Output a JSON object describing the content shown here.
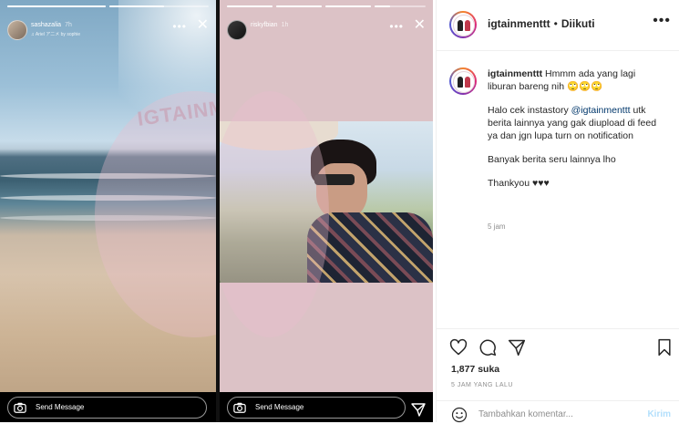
{
  "stories": {
    "left": {
      "username": "sashazalia",
      "time": "7h",
      "music": "♫ Ariel ア二メ by sophie",
      "reply_placeholder": "Send Message",
      "progress": [
        1,
        0.55
      ]
    },
    "right": {
      "username": "riskyfbian",
      "time": "1h",
      "reply_placeholder": "Send Message",
      "progress": [
        1,
        1,
        1,
        0.3
      ]
    },
    "watermark": "IGTAINMENTTT"
  },
  "post": {
    "header": {
      "username": "igtainmenttt",
      "separator": "•",
      "follow_label": "Diikuti"
    },
    "caption": {
      "username": "igtainmenttt",
      "line1": "Hmmm ada yang lagi liburan bareng nih 🙄🙄🙄",
      "para2_before": "Halo cek instastory ",
      "para2_mention": "@igtainmenttt",
      "para2_after": " utk berita lainnya yang gak diupload di feed ya dan jgn lupa turn on notification",
      "para3": "Banyak berita seru lainnya lho",
      "para4": "Thankyou ♥♥♥",
      "time": "5 jam"
    },
    "likes": "1,877 suka",
    "posted_ago": "5 JAM YANG LALU",
    "comment_placeholder": "Tambahkan komentar...",
    "send_label": "Kirim",
    "colors": {
      "link": "#00376b",
      "send_disabled": "#b2dffc",
      "muted": "#8e8e8e"
    }
  }
}
